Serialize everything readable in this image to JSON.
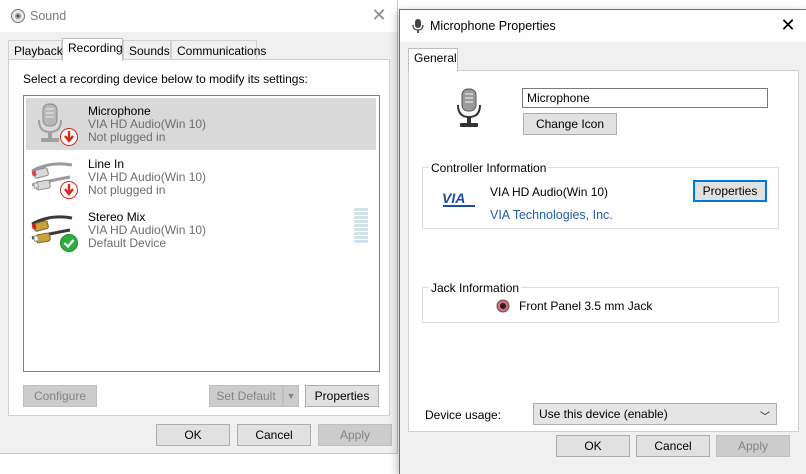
{
  "sound": {
    "title": "Sound",
    "tabs": [
      {
        "label": "Playback"
      },
      {
        "label": "Recording"
      },
      {
        "label": "Sounds"
      },
      {
        "label": "Communications"
      }
    ],
    "instruction": "Select a recording device below to modify its settings:",
    "devices": [
      {
        "name": "Microphone",
        "driver": "VIA HD Audio(Win 10)",
        "status": "Not plugged in",
        "icon": "microphone-icon",
        "badge": "unplugged-arrow-icon"
      },
      {
        "name": "Line In",
        "driver": "VIA HD Audio(Win 10)",
        "status": "Not plugged in",
        "icon": "rca-cable-icon",
        "badge": "unplugged-arrow-icon"
      },
      {
        "name": "Stereo Mix",
        "driver": "VIA HD Audio(Win 10)",
        "status": "Default Device",
        "icon": "rca-cable-icon",
        "badge": "default-check-icon"
      }
    ],
    "buttons": {
      "configure": "Configure",
      "set_default": "Set Default",
      "properties": "Properties",
      "ok": "OK",
      "cancel": "Cancel",
      "apply": "Apply"
    }
  },
  "mic": {
    "title": "Microphone Properties",
    "tab": "General",
    "device_name_value": "Microphone",
    "change_icon": "Change Icon",
    "controller": {
      "title": "Controller Information",
      "name": "VIA HD Audio(Win 10)",
      "vendor": "VIA Technologies, Inc.",
      "properties": "Properties",
      "logo_text": "VIA"
    },
    "jack": {
      "title": "Jack Information",
      "value": "Front Panel 3.5 mm Jack"
    },
    "usage": {
      "label": "Device usage:",
      "selected": "Use this device (enable)"
    },
    "buttons": {
      "ok": "OK",
      "cancel": "Cancel",
      "apply": "Apply"
    }
  },
  "colors": {
    "accent": "#0078d7",
    "selected_row": "#d9d9d9",
    "disabled_text": "#838383",
    "badge_red": "#d9281c",
    "badge_green": "#2fae3f",
    "link": "#1f5fa8"
  }
}
